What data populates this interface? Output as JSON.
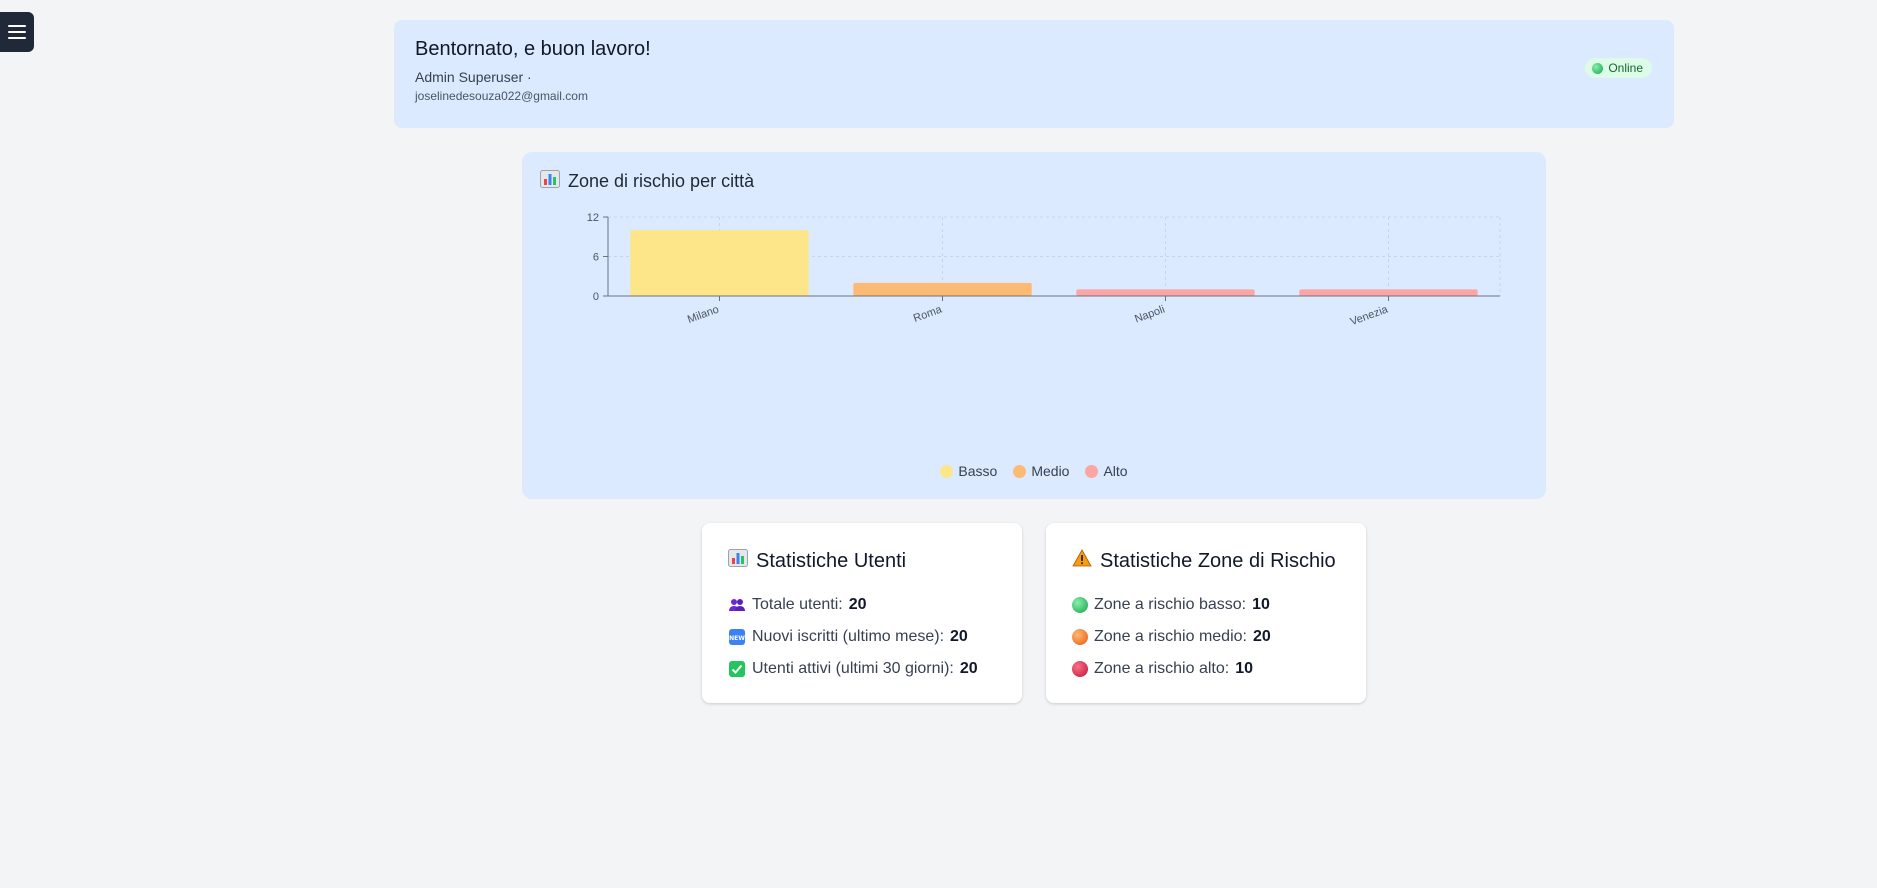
{
  "menu": {
    "icon": "hamburger-menu-icon"
  },
  "welcome": {
    "title": "Bentornato, e buon lavoro!",
    "user": "Admin Superuser ·",
    "email": "joselinedesouza022@gmail.com",
    "status": "Online",
    "status_color": "#16a34a"
  },
  "chart_card": {
    "title": "Zone di rischio per città",
    "icon": "bar-chart-icon"
  },
  "chart_data": {
    "type": "bar",
    "categories": [
      "Milano",
      "Roma",
      "Napoli",
      "Venezia"
    ],
    "series": [
      {
        "name": "Basso",
        "values": [
          10,
          0,
          0,
          0
        ],
        "color": "#fde68a"
      },
      {
        "name": "Medio",
        "values": [
          0,
          2,
          0,
          0
        ],
        "color": "#fdba74"
      },
      {
        "name": "Alto",
        "values": [
          0,
          0,
          1,
          1
        ],
        "color": "#fca5a5"
      }
    ],
    "stacked": true,
    "yticks": [
      "0",
      "6",
      "12"
    ],
    "ylim": [
      0,
      12
    ],
    "grid": true,
    "legend": "bottom"
  },
  "users_stats": {
    "title": "Statistiche Utenti",
    "icon": "bar-chart-icon",
    "rows": [
      {
        "icon": "people-icon",
        "label": "Totale utenti:",
        "value": "20"
      },
      {
        "icon": "new-badge-icon",
        "label": "Nuovi iscritti (ultimo mese):",
        "value": "20"
      },
      {
        "icon": "check-mark-icon",
        "label": "Utenti attivi (ultimi 30 giorni):",
        "value": "20"
      }
    ]
  },
  "zones_stats": {
    "title": "Statistiche Zone di Rischio",
    "icon": "warning-icon",
    "rows": [
      {
        "icon": "green-circle-icon",
        "color": "#22c55e",
        "label": "Zone a rischio basso:",
        "value": "10"
      },
      {
        "icon": "orange-circle-icon",
        "color": "#f97316",
        "label": "Zone a rischio medio:",
        "value": "20"
      },
      {
        "icon": "red-circle-icon",
        "color": "#e11d48",
        "label": "Zone a rischio alto:",
        "value": "10"
      }
    ]
  }
}
